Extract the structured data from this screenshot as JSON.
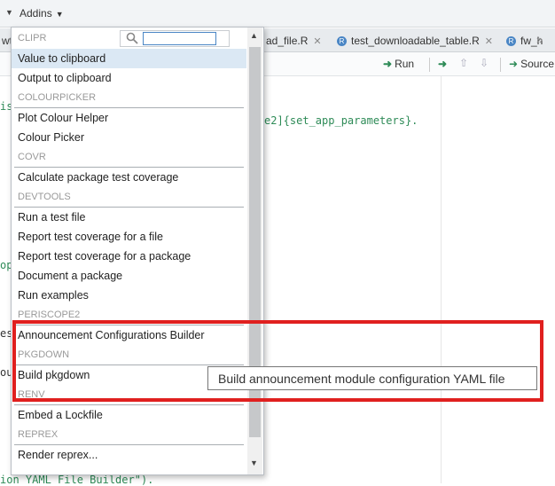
{
  "toolbar": {
    "addins_label": "Addins"
  },
  "tabs": [
    {
      "label": "wt"
    },
    {
      "label": "ad_file.R"
    },
    {
      "label": "test_downloadable_table.R"
    },
    {
      "label": "fw_h"
    }
  ],
  "editor_toolbar": {
    "run_label": "Run",
    "source_label": "Source"
  },
  "code": {
    "line1": "is",
    "line2": "e2]{set_app_parameters}.",
    "line3": "op",
    "line4": "es",
    "line5": "ou",
    "last_line": "ion YAML File Builder\")."
  },
  "menu": {
    "search_placeholder": "",
    "sections": [
      {
        "header": "CLIPR",
        "items": [
          "Value to clipboard",
          "Output to clipboard"
        ]
      },
      {
        "header": "COLOURPICKER",
        "items": [
          "Plot Colour Helper",
          "Colour Picker"
        ]
      },
      {
        "header": "COVR",
        "items": [
          "Calculate package test coverage"
        ]
      },
      {
        "header": "DEVTOOLS",
        "items": [
          "Run a test file",
          "Report test coverage for a file",
          "Report test coverage for a package",
          "Document a package",
          "Run examples"
        ]
      },
      {
        "header": "PERISCOPE2",
        "items": [
          "Announcement Configurations Builder"
        ]
      },
      {
        "header": "PKGDOWN",
        "items": [
          "Build pkgdown"
        ]
      },
      {
        "header": "RENV",
        "items": [
          "Embed a Lockfile"
        ]
      },
      {
        "header": "REPREX",
        "items": [
          "Render reprex..."
        ]
      }
    ]
  },
  "tooltip": {
    "text": "Build announcement module configuration YAML file"
  },
  "colors": {
    "highlight": "#e0201f",
    "selected_item": "#dbe8f4",
    "accent": "#4a86c5"
  }
}
